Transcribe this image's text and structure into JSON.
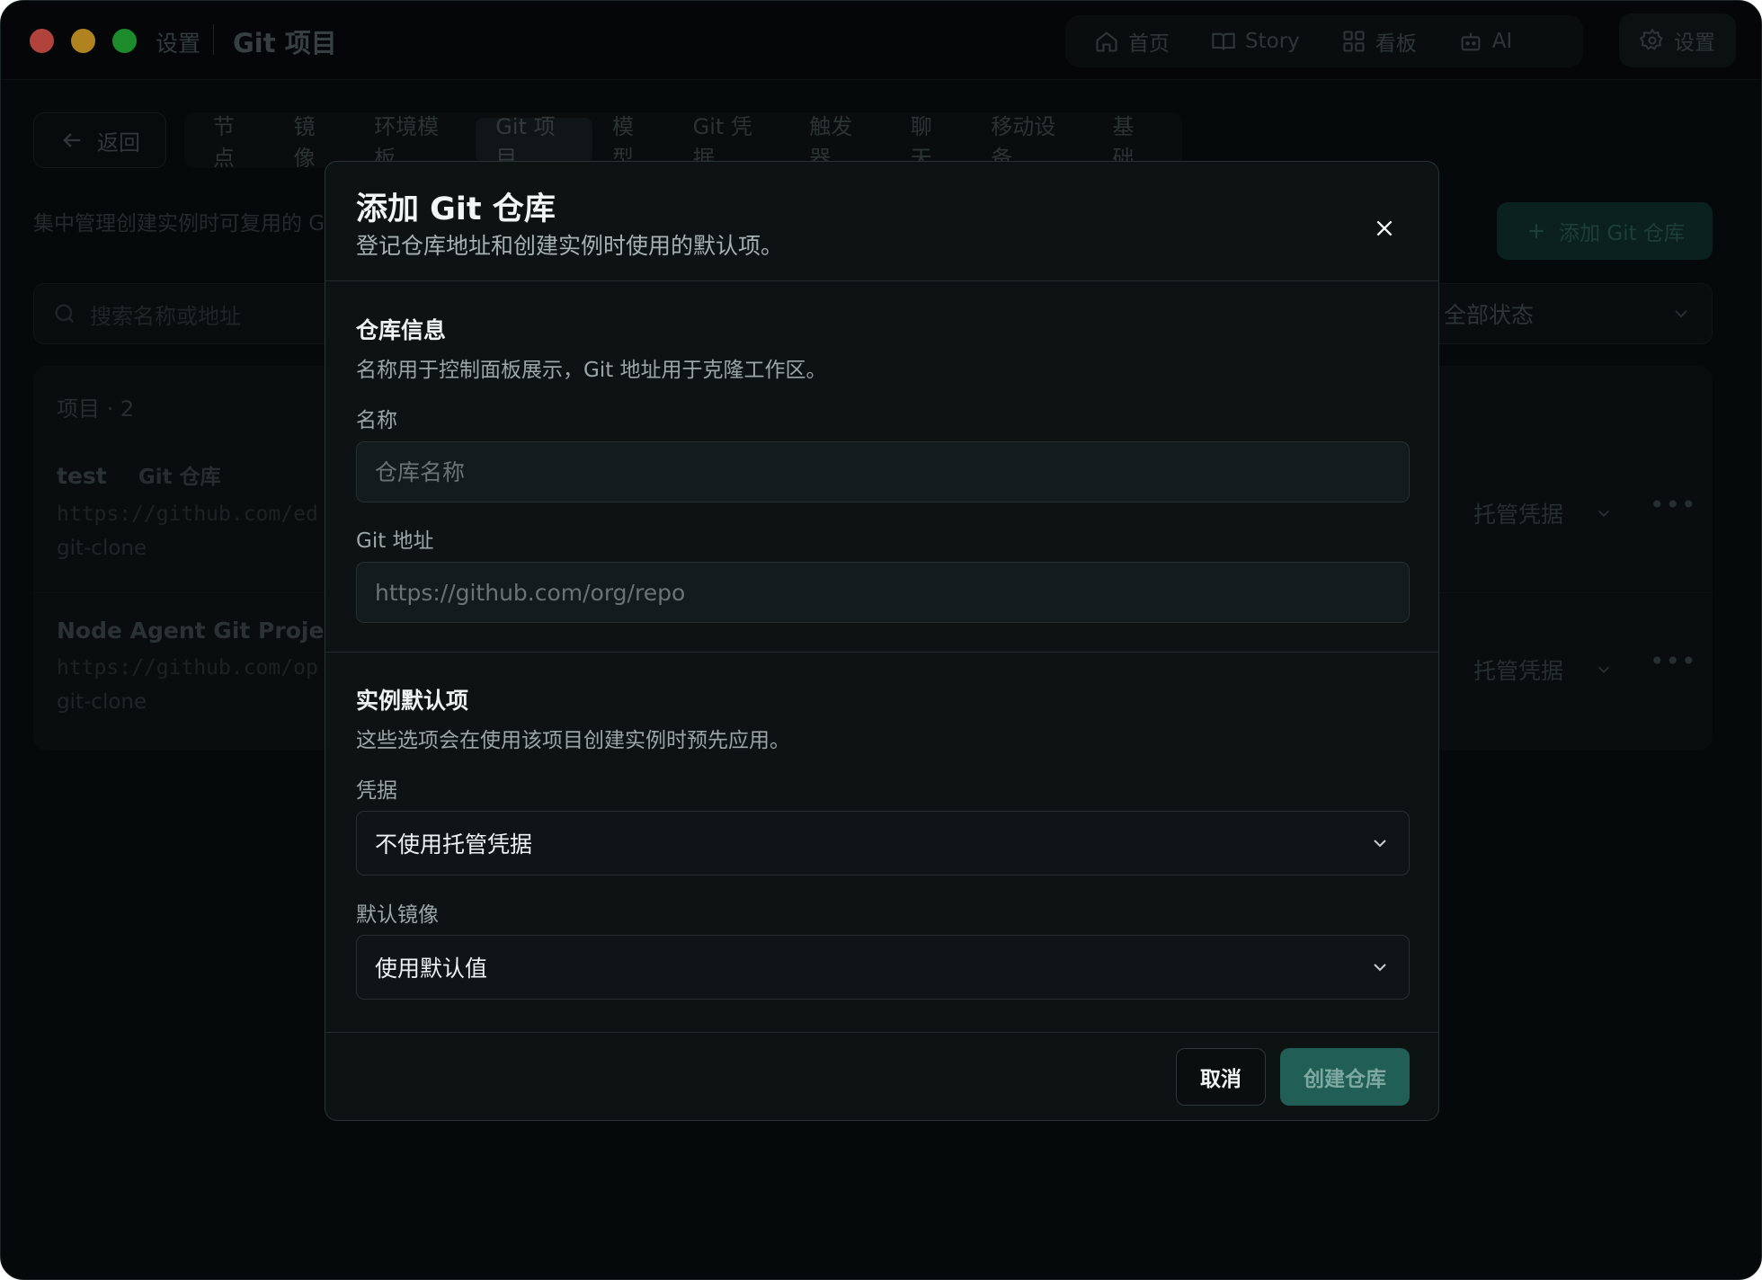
{
  "titlebar": {
    "crumb": "设置",
    "title": "Git 项目"
  },
  "topnav": {
    "items": [
      {
        "label": "首页",
        "icon": "home-icon"
      },
      {
        "label": "Story",
        "icon": "book-icon"
      },
      {
        "label": "看板",
        "icon": "grid-icon"
      },
      {
        "label": "AI",
        "icon": "robot-icon"
      }
    ],
    "settings_label": "设置"
  },
  "page": {
    "back_label": "返回",
    "tabs": [
      {
        "label": "节点"
      },
      {
        "label": "镜像"
      },
      {
        "label": "环境模板"
      },
      {
        "label": "Git 项目",
        "active": true
      },
      {
        "label": "模型"
      },
      {
        "label": "Git 凭据"
      },
      {
        "label": "触发器"
      },
      {
        "label": "聊天"
      },
      {
        "label": "移动设备"
      },
      {
        "label": "基础"
      }
    ],
    "description": "集中管理创建实例时可复用的 G",
    "add_button": "添加 Git 仓库",
    "search_placeholder": "搜索名称或地址",
    "status_filter": "全部状态",
    "count_label": "项目 · 2",
    "rows": [
      {
        "name": "test",
        "tag": "Git 仓库",
        "url": "https://github.com/ed",
        "type": "git-clone",
        "credential": "托管凭据"
      },
      {
        "name": "Node Agent Git Project",
        "tag": "",
        "url": "https://github.com/op",
        "type": "git-clone",
        "credential": "托管凭据"
      }
    ]
  },
  "modal": {
    "title": "添加 Git 仓库",
    "subtitle": "登记仓库地址和创建实例时使用的默认项。",
    "section1": {
      "title": "仓库信息",
      "description": "名称用于控制面板展示，Git 地址用于克隆工作区。",
      "name_label": "名称",
      "name_placeholder": "仓库名称",
      "name_value": "",
      "url_label": "Git 地址",
      "url_placeholder": "https://github.com/org/repo",
      "url_value": ""
    },
    "section2": {
      "title": "实例默认项",
      "description": "这些选项会在使用该项目创建实例时预先应用。",
      "credential_label": "凭据",
      "credential_value": "不使用托管凭据",
      "image_label": "默认镜像",
      "image_value": "使用默认值"
    },
    "cancel_label": "取消",
    "create_label": "创建仓库"
  }
}
